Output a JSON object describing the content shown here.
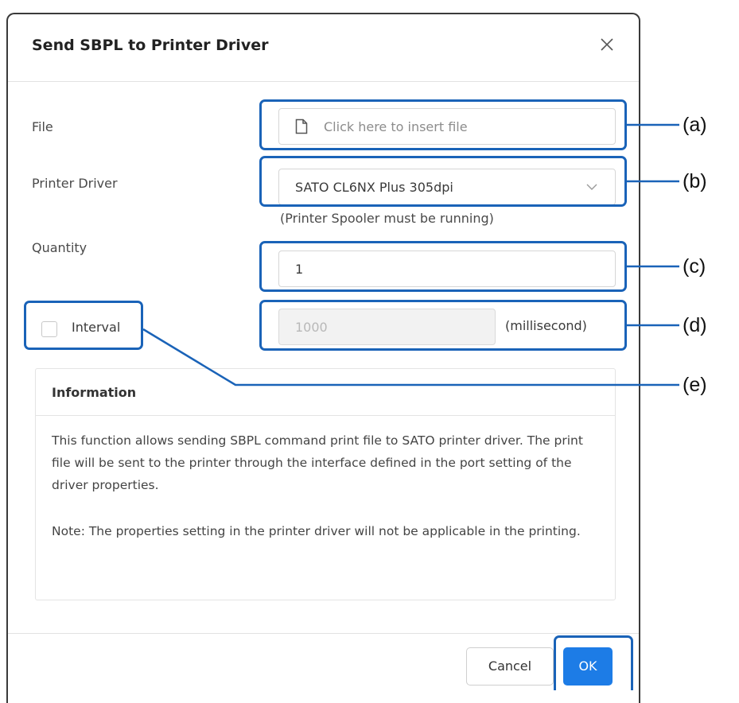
{
  "dialog": {
    "title": "Send SBPL to Printer Driver",
    "close_icon": "close-icon"
  },
  "form": {
    "file_label": "File",
    "file_placeholder": "Click here to insert file",
    "file_icon": "file-icon",
    "printer_driver_label": "Printer Driver",
    "printer_driver_value": "SATO CL6NX Plus 305dpi",
    "printer_driver_hint": "(Printer Spooler must be running)",
    "quantity_label": "Quantity",
    "quantity_value": "1",
    "interval_label": "Interval",
    "interval_checked": false,
    "interval_value": "1000",
    "interval_unit": "(millisecond)"
  },
  "information": {
    "title": "Information",
    "paragraphs": [
      "This function allows sending SBPL command print file to SATO printer driver. The print file will be sent to the printer through the interface defined in the port setting of the driver properties.",
      "Note: The properties setting in the printer driver will not be applicable in the printing."
    ]
  },
  "footer": {
    "cancel_label": "Cancel",
    "ok_label": "OK"
  },
  "callouts": [
    "(a)",
    "(b)",
    "(c)",
    "(d)",
    "(e)"
  ],
  "colors": {
    "accent": "#1d7ce6",
    "callout": "#1a63b8"
  }
}
